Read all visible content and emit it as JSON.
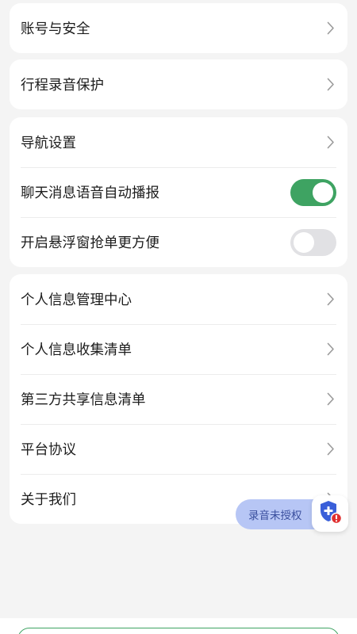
{
  "colors": {
    "accent": "#3ea362",
    "toggle_off": "#e1e1e4",
    "floating_bg": "#b7c6f5",
    "floating_text": "#3a4f9e",
    "alert": "#e03030",
    "shield": "#3a5fd9"
  },
  "sections": [
    {
      "items": [
        {
          "label": "账号与安全",
          "type": "link",
          "icon": "chevron-right-icon"
        }
      ]
    },
    {
      "items": [
        {
          "label": "行程录音保护",
          "type": "link",
          "icon": "chevron-right-icon"
        }
      ]
    },
    {
      "items": [
        {
          "label": "导航设置",
          "type": "link",
          "icon": "chevron-right-icon"
        },
        {
          "label": "聊天消息语音自动播报",
          "type": "toggle",
          "enabled": true
        },
        {
          "label": "开启悬浮窗抢单更方便",
          "type": "toggle",
          "enabled": false
        }
      ]
    },
    {
      "items": [
        {
          "label": "个人信息管理中心",
          "type": "link",
          "icon": "chevron-right-icon"
        },
        {
          "label": "个人信息收集清单",
          "type": "link",
          "icon": "chevron-right-icon"
        },
        {
          "label": "第三方共享信息清单",
          "type": "link",
          "icon": "chevron-right-icon"
        },
        {
          "label": "平台协议",
          "type": "link",
          "icon": "chevron-right-icon"
        },
        {
          "label": "关于我们",
          "type": "link",
          "icon": "chevron-right-icon"
        }
      ]
    }
  ],
  "floating": {
    "label": "录音未授权",
    "icon": "shield-alert-icon"
  }
}
